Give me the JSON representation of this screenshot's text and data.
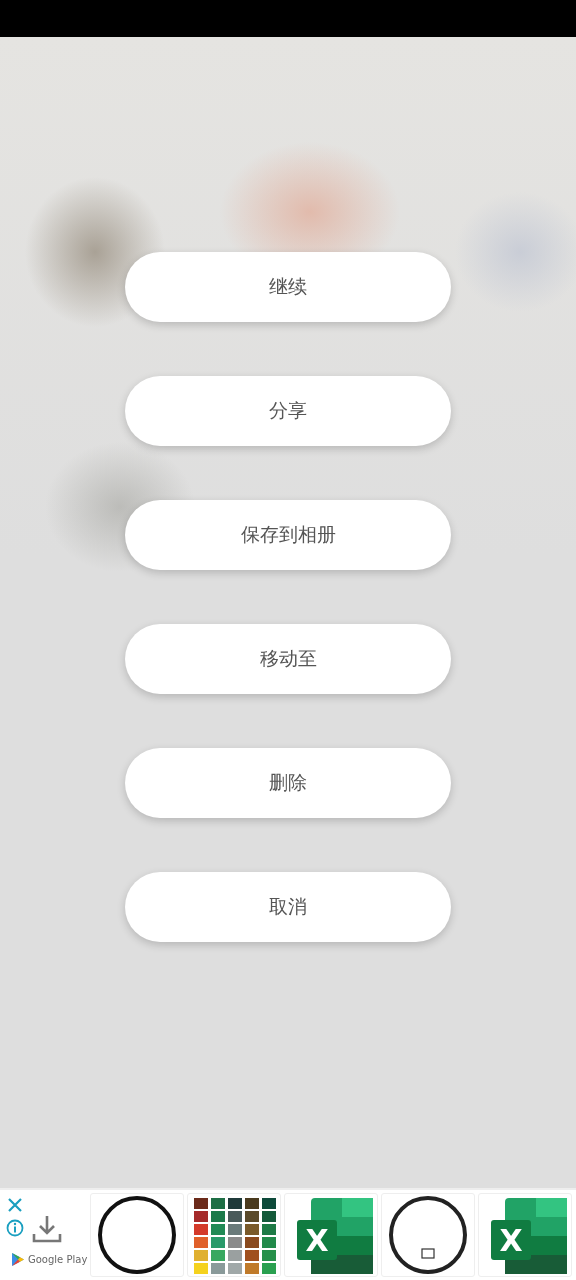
{
  "menu": [
    {
      "label": "继续"
    },
    {
      "label": "分享"
    },
    {
      "label": "保存到相册"
    },
    {
      "label": "移动至"
    },
    {
      "label": "删除"
    },
    {
      "label": "取消"
    }
  ],
  "ad": {
    "store_label": "Google Play",
    "thumbnails": [
      {
        "kind": "ring"
      },
      {
        "kind": "palette"
      },
      {
        "kind": "app_icon",
        "letter": "X"
      },
      {
        "kind": "ring_logo"
      },
      {
        "kind": "app_icon",
        "letter": "X"
      }
    ]
  }
}
